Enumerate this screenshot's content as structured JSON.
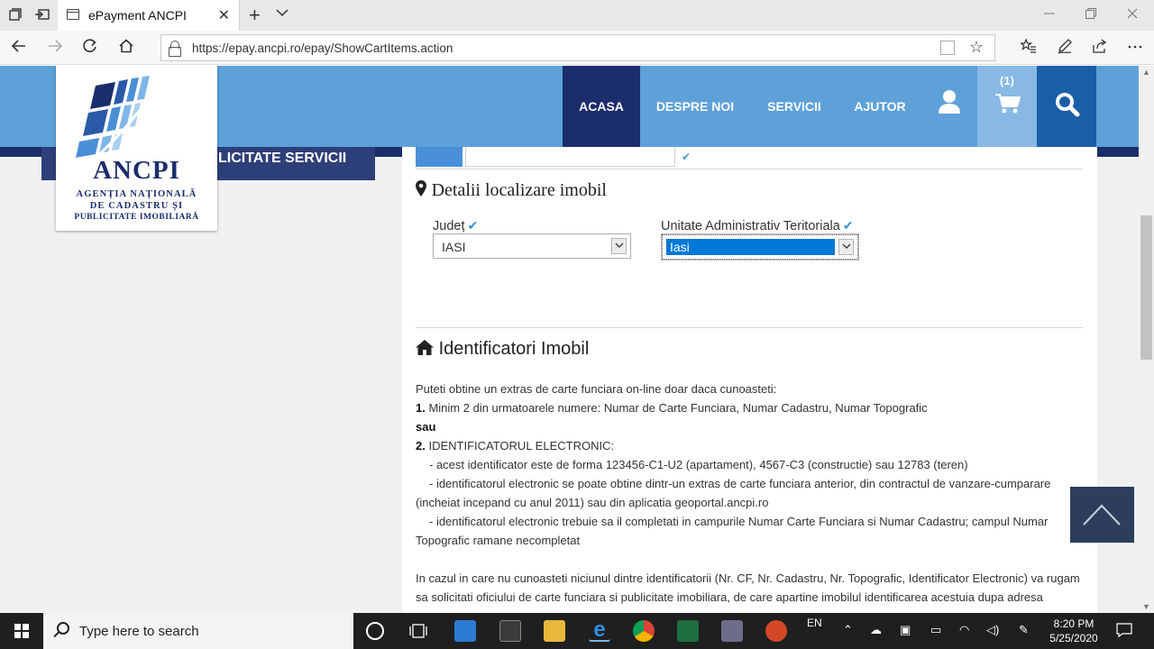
{
  "browser": {
    "tab_title": "ePayment ANCPI",
    "url": "https://epay.ancpi.ro/epay/ShowCartItems.action",
    "new_tab_symbol": "+",
    "close_symbol": "✕"
  },
  "site": {
    "logo_brand": "ANCPI",
    "logo_line1": "AGENȚIA NAȚIONALĂ",
    "logo_line2": "DE CADASTRU ȘI",
    "logo_line3": "PUBLICITATE IMOBILIARĂ",
    "nav": [
      "ACASA",
      "DESPRE NOI",
      "SERVICII",
      "AJUTOR"
    ],
    "cart_count": "(1)",
    "sidebar_heading": "LICITATE SERVICII"
  },
  "location": {
    "title": "Detalii localizare imobil",
    "judet_label": "Județ",
    "judet_value": "IASI",
    "uat_label": "Unitate Administrativ Teritoriala",
    "uat_value": "Iasi"
  },
  "identifiers": {
    "title": "Identificatori Imobil",
    "intro": "Puteti obtine un extras de carte funciara on-line doar daca cunoasteti:",
    "opt1_num": "1.",
    "opt1": "Minim 2 din urmatoarele numere: Numar de Carte Funciara, Numar Cadastru, Numar Topografic",
    "or": "sau",
    "opt2_num": "2.",
    "opt2": "IDENTIFICATORUL ELECTRONIC:",
    "b1": "- acest identificator este de forma 123456-C1-U2 (apartament), 4567-C3 (constructie) sau 12783 (teren)",
    "b2a": "- identificatorul electronic se poate obtine dintr-un extras de carte funciara anterior, din contractul de vanzare-cumparare",
    "b2b": "(incheiat incepand cu anul 2011) sau din aplicatia geoportal.ancpi.ro",
    "b3a": "- identificatorul electronic trebuie sa il completati in campurile Numar Carte Funciara si Numar Cadastru; campul Numar",
    "b3b": "Topografic ramane necompletat",
    "p2a": "In cazul in care nu cunoasteti niciunul dintre identificatorii (Nr. CF, Nr. Cadastru, Nr. Topografic, Identificator Electronic) va rugam",
    "p2b": "sa solicitati oficiului de carte funciara si publicitate imobiliara, de care apartine imobilul identificarea acestuia dupa adresa"
  },
  "taskbar": {
    "search_placeholder": "Type here to search",
    "lang": "EN",
    "time": "8:20 PM",
    "date": "5/25/2020"
  },
  "colors": {
    "header_blue": "#5ea1d9",
    "navy": "#1b2d6b",
    "search_blue": "#1a5ea8",
    "selection": "#0078d7"
  },
  "icons": [
    "tab-actions-icon",
    "tab-aside-icon",
    "page-icon",
    "lock-icon",
    "back-arrow-icon",
    "forward-arrow-icon",
    "refresh-icon",
    "home-icon",
    "reading-view-icon",
    "favorite-star-icon",
    "favorites-hub-icon",
    "pen-icon",
    "share-icon",
    "more-icon",
    "user-icon",
    "cart-icon",
    "search-icon",
    "map-marker-icon",
    "house-icon",
    "chevron-up-icon",
    "windows-icon"
  ]
}
